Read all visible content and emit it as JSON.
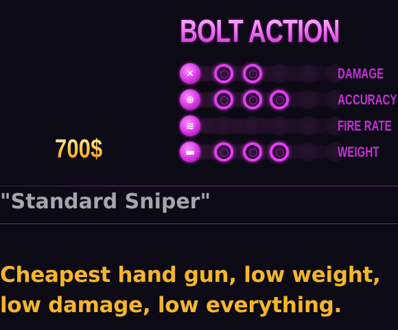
{
  "weapon": {
    "class": "BOLT ACTION",
    "price": "700$",
    "name": "\"Standard Sniper\"",
    "description_lines": [
      "Cheapest hand gun, low weight,",
      " low damage, low everything."
    ]
  },
  "stats": [
    {
      "label": "DAMAGE",
      "icon": "crossed-bullets-icon",
      "level": 2,
      "max": 5
    },
    {
      "label": "ACCURACY",
      "icon": "crosshair-icon",
      "level": 3,
      "max": 5
    },
    {
      "label": "FIRE RATE",
      "icon": "burst-fire-icon",
      "level": 0,
      "max": 5
    },
    {
      "label": "WEIGHT",
      "icon": "weight-icon",
      "level": 3,
      "max": 5
    }
  ],
  "colors": {
    "accent_magenta": "#e23ff0",
    "label_magenta": "#c72fd8",
    "price_gold": "#ffc13a",
    "description_gold": "#f6b629",
    "name_gray": "#a8a4ae",
    "background": "#0c0a14"
  }
}
